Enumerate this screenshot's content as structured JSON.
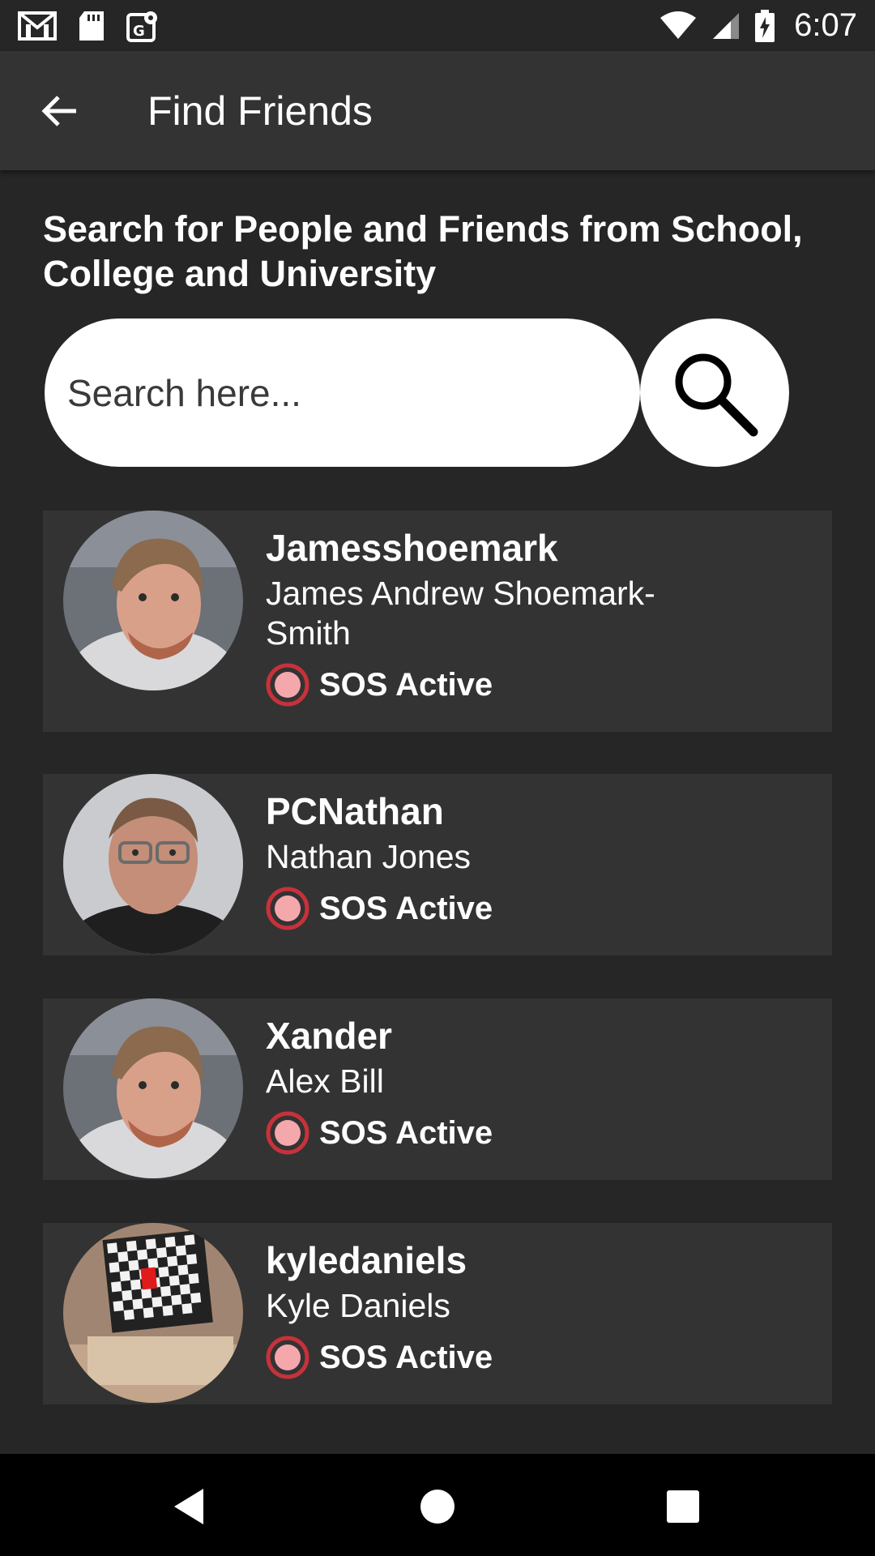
{
  "status_bar": {
    "time": "6:07",
    "left_icons": [
      "gmail-icon",
      "sd-card-icon",
      "maps-icon"
    ],
    "right_icons": [
      "wifi-icon",
      "signal-icon",
      "battery-charging-icon"
    ]
  },
  "app_bar": {
    "title": "Find Friends"
  },
  "heading": "Search for People and Friends from School, College and University",
  "search": {
    "placeholder": "Search here..."
  },
  "colors": {
    "background": "#262626",
    "surface": "#333333",
    "sos_ring": "#c8313b",
    "sos_fill": "#f4a8ac"
  },
  "results": [
    {
      "username": "Jamesshoemark",
      "fullname": "James Andrew Shoemark-Smith",
      "status": "SOS Active",
      "avatar": "photo-young-man-hoodie"
    },
    {
      "username": "PCNathan",
      "fullname": "Nathan Jones",
      "status": "SOS Active",
      "avatar": "photo-man-glasses"
    },
    {
      "username": "Xander",
      "fullname": "Alex Bill",
      "status": "SOS Active",
      "avatar": "photo-young-man-hoodie"
    },
    {
      "username": "kyledaniels",
      "fullname": "Kyle Daniels",
      "status": "SOS Active",
      "avatar": "photo-tv-checkerboard"
    }
  ],
  "nav_bar": {
    "buttons": [
      "back-triangle-icon",
      "home-circle-icon",
      "recents-square-icon"
    ]
  }
}
